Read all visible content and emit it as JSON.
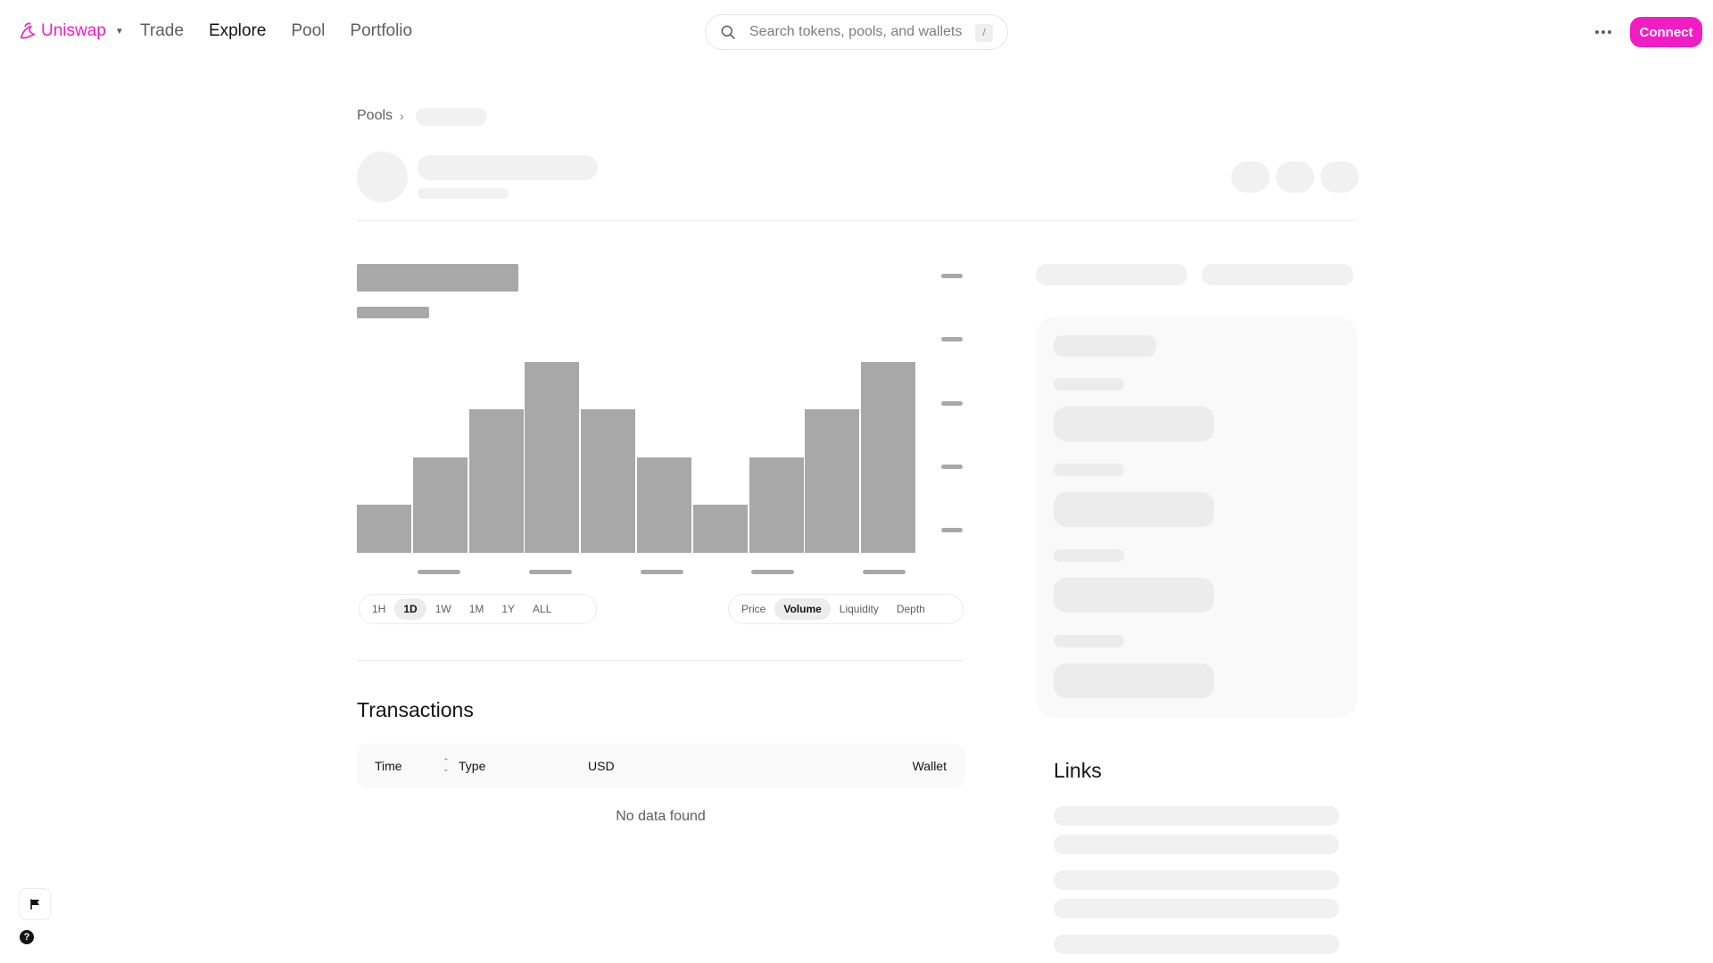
{
  "nav": {
    "brand": "Uniswap",
    "links": [
      "Trade",
      "Explore",
      "Pool",
      "Portfolio"
    ],
    "active_link": "Explore",
    "search_placeholder": "Search tokens, pools, and wallets",
    "search_shortcut": "/",
    "connect_label": "Connect",
    "brand_color": "#f21dc2"
  },
  "breadcrumb": {
    "pools_label": "Pools"
  },
  "chart_controls": {
    "time_ranges": [
      "1H",
      "1D",
      "1W",
      "1M",
      "1Y",
      "ALL"
    ],
    "active_time_range": "1D",
    "chart_types": [
      "Price",
      "Volume",
      "Liquidity",
      "Depth"
    ],
    "active_chart_type": "Volume"
  },
  "chart_data": {
    "type": "bar",
    "values": [
      1,
      2,
      3,
      4,
      3,
      2,
      1,
      2,
      3,
      4
    ],
    "ylim": [
      0,
      4
    ]
  },
  "transactions": {
    "title": "Transactions",
    "columns": [
      "Time",
      "Type",
      "USD",
      "Wallet"
    ],
    "empty_text": "No data found"
  },
  "links": {
    "title": "Links"
  }
}
